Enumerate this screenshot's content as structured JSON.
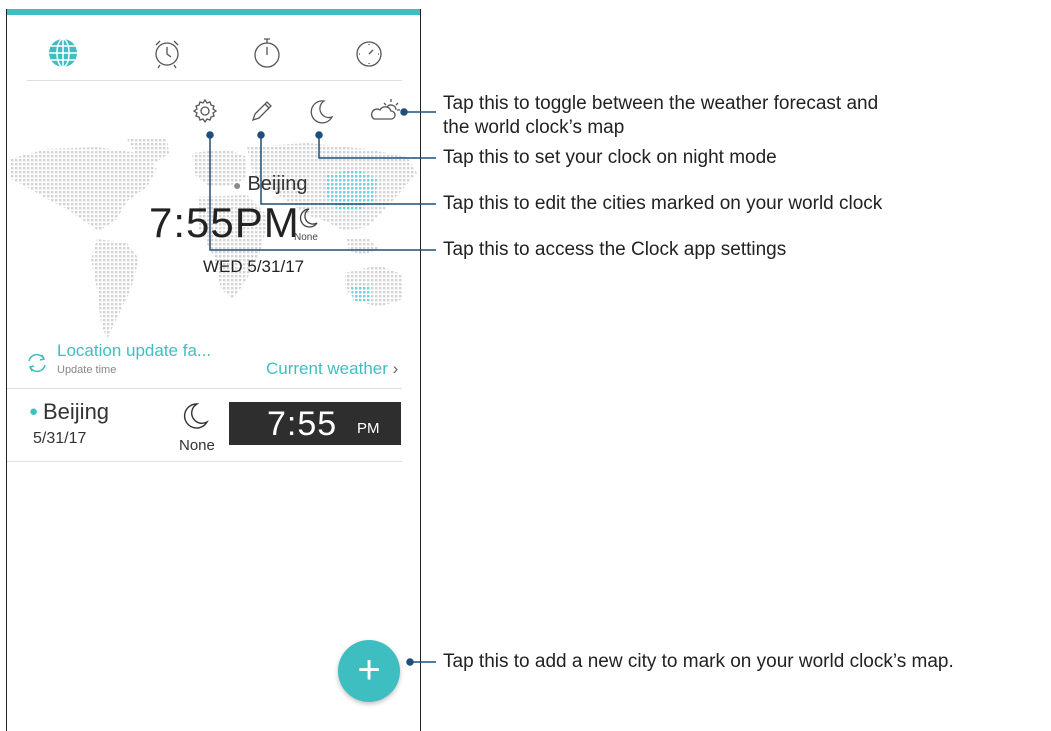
{
  "tabs": [
    {
      "name": "world-clock",
      "icon": "globe-icon",
      "active": true
    },
    {
      "name": "alarm",
      "icon": "alarm-icon"
    },
    {
      "name": "stopwatch",
      "icon": "stopwatch-icon"
    },
    {
      "name": "timer",
      "icon": "timer-icon"
    }
  ],
  "toolbar": {
    "settings_icon": "gear-icon",
    "edit_icon": "pencil-icon",
    "night_mode_icon": "moon-icon",
    "weather_icon": "partly-cloudy-icon"
  },
  "map_clock": {
    "city": "Beijing",
    "time": "7:55PM",
    "weather": "None",
    "date": "WED 5/31/17"
  },
  "location": {
    "title": "Location update fa...",
    "subtitle": "Update time",
    "current_weather": "Current weather",
    "current_weather_chevron": "›"
  },
  "city_card": {
    "city": "Beijing",
    "date": "5/31/17",
    "weather": "None",
    "time": "7:55",
    "ampm": "PM"
  },
  "fab": {
    "symbol": "+"
  },
  "callouts": {
    "weather_toggle": "Tap this to toggle between the weather forecast and",
    "weather_toggle_2": "the world clock’s map",
    "night_mode": "Tap this to set your clock on night mode",
    "edit_cities": "Tap this to edit the cities marked on your world clock",
    "settings": "Tap this to access the Clock app settings",
    "add_city": "Tap this to add a new city to mark on your world clock’s map."
  },
  "colors": {
    "accent": "#3fbec2",
    "clock_bg": "#2e2e2e",
    "callout_line": "#1f4e7a"
  }
}
